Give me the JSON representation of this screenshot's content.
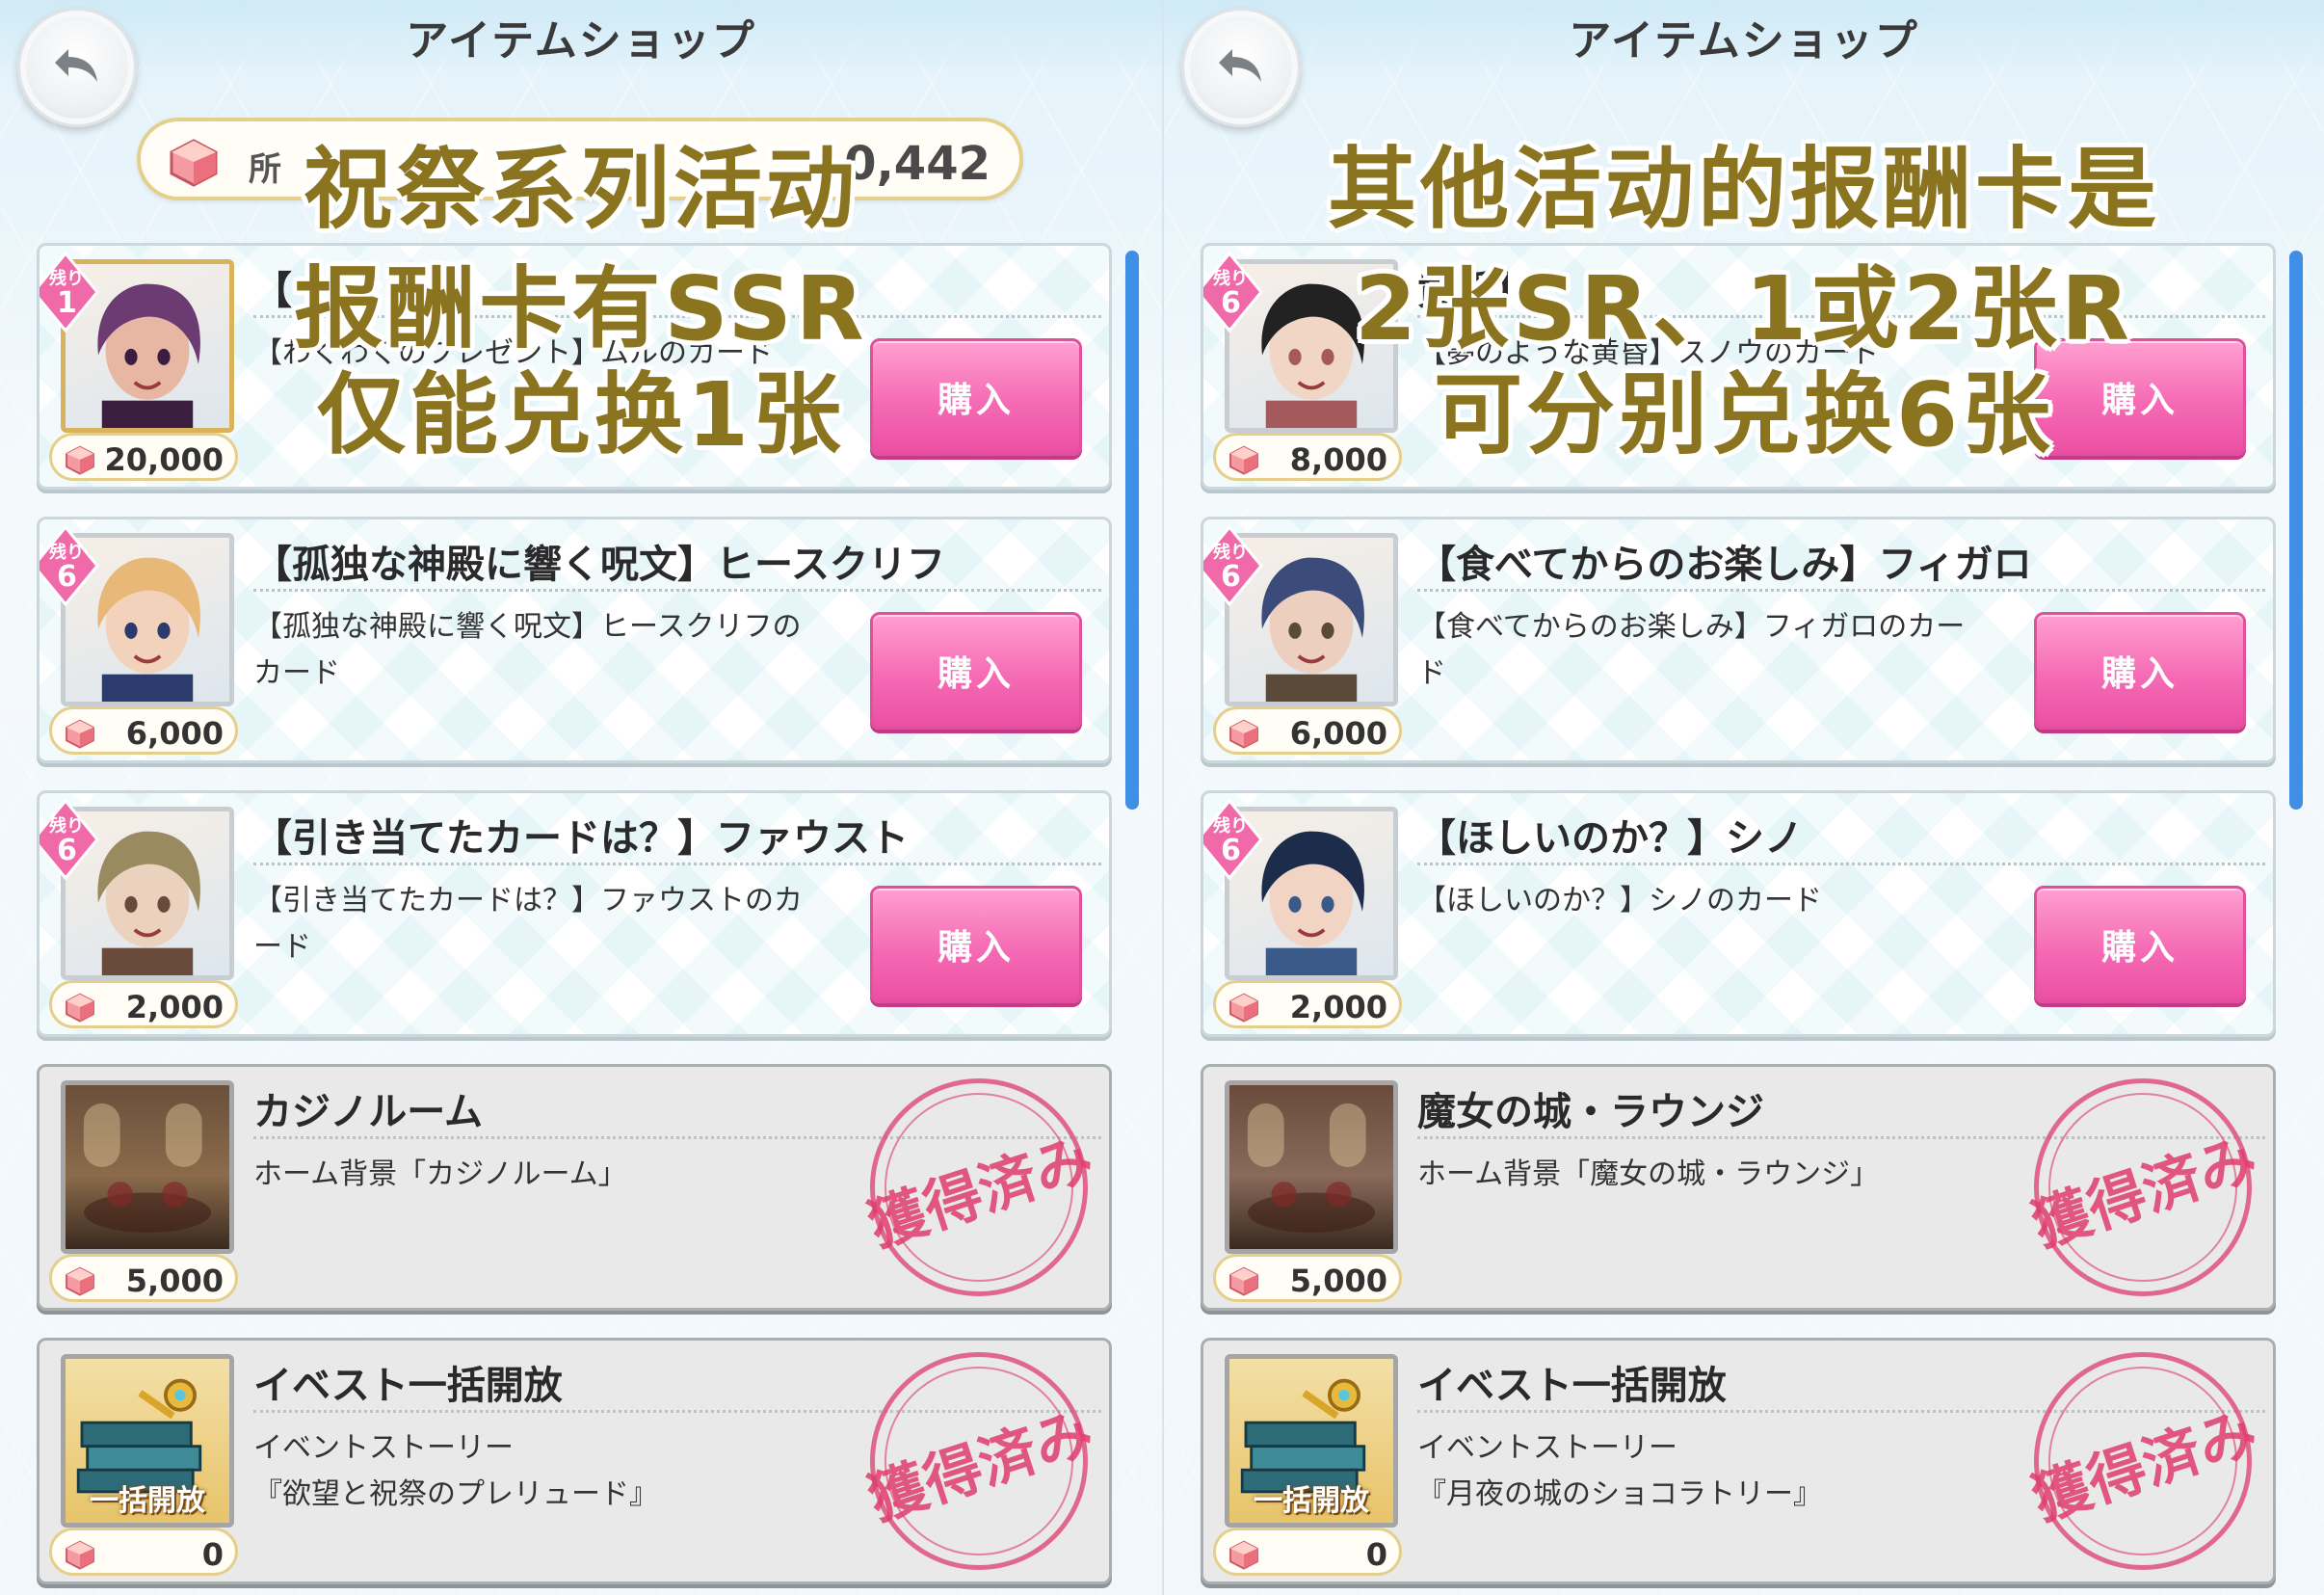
{
  "left": {
    "title": "アイテムショップ",
    "currency": {
      "label": "所",
      "amount": "0,442"
    },
    "overlay": [
      "祝祭系列活动",
      "报酬卡有SSR",
      "仅能兑换1张"
    ],
    "items": [
      {
        "remain_label": "残り",
        "remain": "1",
        "title": "【",
        "desc": "【わくわくのプレゼント】ムルのカード",
        "price": "20,000",
        "button": "購入",
        "owned": false
      },
      {
        "remain_label": "残り",
        "remain": "6",
        "title": "【孤独な神殿に響く呪文】ヒースクリフ",
        "desc": "【孤独な神殿に響く呪文】ヒースクリフのカード",
        "price": "6,000",
        "button": "購入",
        "owned": false
      },
      {
        "remain_label": "残り",
        "remain": "6",
        "title": "【引き当てたカードは？】ファウスト",
        "desc": "【引き当てたカードは？】ファウストのカード",
        "price": "2,000",
        "button": "購入",
        "owned": false
      },
      {
        "title": "カジノルーム",
        "desc": "ホーム背景「カジノルーム」",
        "price": "5,000",
        "stamp": "獲得済み",
        "owned": true
      },
      {
        "title": "イベスト一括開放",
        "desc": "イベントストーリー\n『欲望と祝祭のプレリュード』",
        "price": "0",
        "stamp": "獲得済み",
        "thumb_label": "一括開放",
        "owned": true
      }
    ]
  },
  "right": {
    "title": "アイテムショップ",
    "overlay": [
      "其他活动的报酬卡是",
      "2张SR、1或2张R",
      "可分别兑换6张"
    ],
    "items": [
      {
        "remain_label": "残り",
        "remain": "6",
        "title": "黄昏】",
        "desc": "【夢のような黄昏】スノウのカード",
        "price": "8,000",
        "button": "購入",
        "owned": false
      },
      {
        "remain_label": "残り",
        "remain": "6",
        "title": "【食べてからのお楽しみ】フィガロ",
        "desc": "【食べてからのお楽しみ】フィガロのカード",
        "price": "6,000",
        "button": "購入",
        "owned": false
      },
      {
        "remain_label": "残り",
        "remain": "6",
        "title": "【ほしいのか？】シノ",
        "desc": "【ほしいのか？】シノのカード",
        "price": "2,000",
        "button": "購入",
        "owned": false
      },
      {
        "title": "魔女の城・ラウンジ",
        "desc": "ホーム背景「魔女の城・ラウンジ」",
        "price": "5,000",
        "stamp": "獲得済み",
        "owned": true
      },
      {
        "title": "イベスト一括開放",
        "desc": "イベントストーリー\n『月夜の城のショコラトリー』",
        "price": "0",
        "stamp": "獲得済み",
        "thumb_label": "一括開放",
        "owned": true
      }
    ]
  },
  "colors": {
    "accent_pink": "#f56bb4",
    "overlay_text": "#8b7420",
    "scrollbar": "#3f8fe6",
    "stamp": "#de3c6e"
  },
  "icons": {
    "back": "back-arrow-icon",
    "gem": "gem-currency-icon"
  }
}
